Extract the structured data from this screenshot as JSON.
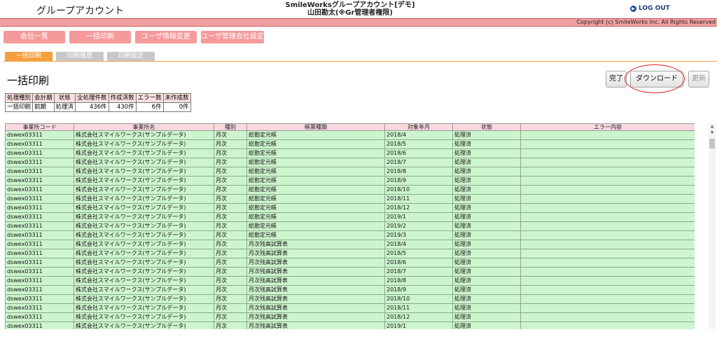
{
  "header": {
    "title": "グループアカウント",
    "center_line1": "SmileWorksグループアカウント[デモ]",
    "center_line2": "山田勘太(※Gr管理者権限)",
    "logout_label": "LOG OUT",
    "copyright": "Copyright (c) SmileWorks Inc. All Rights Reserved"
  },
  "topnav": [
    "会社一覧",
    "一括印刷",
    "ユーザ情報変更",
    "ユーザ管理会社設定"
  ],
  "tabs": [
    "一括印刷",
    "印刷履歴",
    "印刷設定"
  ],
  "page_title": "一括印刷",
  "actions": {
    "complete": "完了",
    "download": "ダウンロード",
    "refresh": "更新"
  },
  "summary": {
    "headers": [
      "処理種別",
      "会計期",
      "状態",
      "全処理件数",
      "作成済数",
      "エラー数",
      "未作成数"
    ],
    "values": [
      "一括印刷",
      "前期",
      "処理済",
      "436件",
      "430件",
      "6件",
      "0件"
    ]
  },
  "grid": {
    "columns": [
      "事業所コード",
      "事業所名",
      "種別",
      "帳票種類",
      "対象年月",
      "状態",
      "エラー内容"
    ],
    "rows": [
      [
        "dswex03311",
        "株式会社スマイルワークス(サンプルデータ)",
        "月次",
        "総勘定元帳",
        "2018/4",
        "処理済",
        ""
      ],
      [
        "dswex03311",
        "株式会社スマイルワークス(サンプルデータ)",
        "月次",
        "総勘定元帳",
        "2018/5",
        "処理済",
        ""
      ],
      [
        "dswex03311",
        "株式会社スマイルワークス(サンプルデータ)",
        "月次",
        "総勘定元帳",
        "2018/6",
        "処理済",
        ""
      ],
      [
        "dswex03311",
        "株式会社スマイルワークス(サンプルデータ)",
        "月次",
        "総勘定元帳",
        "2018/7",
        "処理済",
        ""
      ],
      [
        "dswex03311",
        "株式会社スマイルワークス(サンプルデータ)",
        "月次",
        "総勘定元帳",
        "2018/8",
        "処理済",
        ""
      ],
      [
        "dswex03311",
        "株式会社スマイルワークス(サンプルデータ)",
        "月次",
        "総勘定元帳",
        "2018/9",
        "処理済",
        ""
      ],
      [
        "dswex03311",
        "株式会社スマイルワークス(サンプルデータ)",
        "月次",
        "総勘定元帳",
        "2018/10",
        "処理済",
        ""
      ],
      [
        "dswex03311",
        "株式会社スマイルワークス(サンプルデータ)",
        "月次",
        "総勘定元帳",
        "2018/11",
        "処理済",
        ""
      ],
      [
        "dswex03311",
        "株式会社スマイルワークス(サンプルデータ)",
        "月次",
        "総勘定元帳",
        "2018/12",
        "処理済",
        ""
      ],
      [
        "dswex03311",
        "株式会社スマイルワークス(サンプルデータ)",
        "月次",
        "総勘定元帳",
        "2019/1",
        "処理済",
        ""
      ],
      [
        "dswex03311",
        "株式会社スマイルワークス(サンプルデータ)",
        "月次",
        "総勘定元帳",
        "2019/2",
        "処理済",
        ""
      ],
      [
        "dswex03311",
        "株式会社スマイルワークス(サンプルデータ)",
        "月次",
        "総勘定元帳",
        "2019/3",
        "処理済",
        ""
      ],
      [
        "dswex03311",
        "株式会社スマイルワークス(サンプルデータ)",
        "月次",
        "月次残高試算表",
        "2018/4",
        "処理済",
        ""
      ],
      [
        "dswex03311",
        "株式会社スマイルワークス(サンプルデータ)",
        "月次",
        "月次残高試算表",
        "2018/5",
        "処理済",
        ""
      ],
      [
        "dswex03311",
        "株式会社スマイルワークス(サンプルデータ)",
        "月次",
        "月次残高試算表",
        "2018/6",
        "処理済",
        ""
      ],
      [
        "dswex03311",
        "株式会社スマイルワークス(サンプルデータ)",
        "月次",
        "月次残高試算表",
        "2018/7",
        "処理済",
        ""
      ],
      [
        "dswex03311",
        "株式会社スマイルワークス(サンプルデータ)",
        "月次",
        "月次残高試算表",
        "2018/8",
        "処理済",
        ""
      ],
      [
        "dswex03311",
        "株式会社スマイルワークス(サンプルデータ)",
        "月次",
        "月次残高試算表",
        "2018/9",
        "処理済",
        ""
      ],
      [
        "dswex03311",
        "株式会社スマイルワークス(サンプルデータ)",
        "月次",
        "月次残高試算表",
        "2018/10",
        "処理済",
        ""
      ],
      [
        "dswex03311",
        "株式会社スマイルワークス(サンプルデータ)",
        "月次",
        "月次残高試算表",
        "2018/11",
        "処理済",
        ""
      ],
      [
        "dswex03311",
        "株式会社スマイルワークス(サンプルデータ)",
        "月次",
        "月次残高試算表",
        "2018/12",
        "処理済",
        ""
      ],
      [
        "dswex03311",
        "株式会社スマイルワークス(サンプルデータ)",
        "月次",
        "月次残高試算表",
        "2019/1",
        "処理済",
        ""
      ]
    ]
  },
  "colors": {
    "accent_pink": "#f59a9a",
    "tab_active": "#f5a040",
    "tab_inactive": "#c8c8c8",
    "row_green": "#cdf5cd",
    "header_pink": "#f9d9de",
    "highlight_circle": "#e02020",
    "logout_blue": "#1a3f7a"
  },
  "icons": {
    "logout": "arrow-circle-icon",
    "scroll_up": "triangle-up-icon",
    "scroll_down": "triangle-down-icon"
  }
}
